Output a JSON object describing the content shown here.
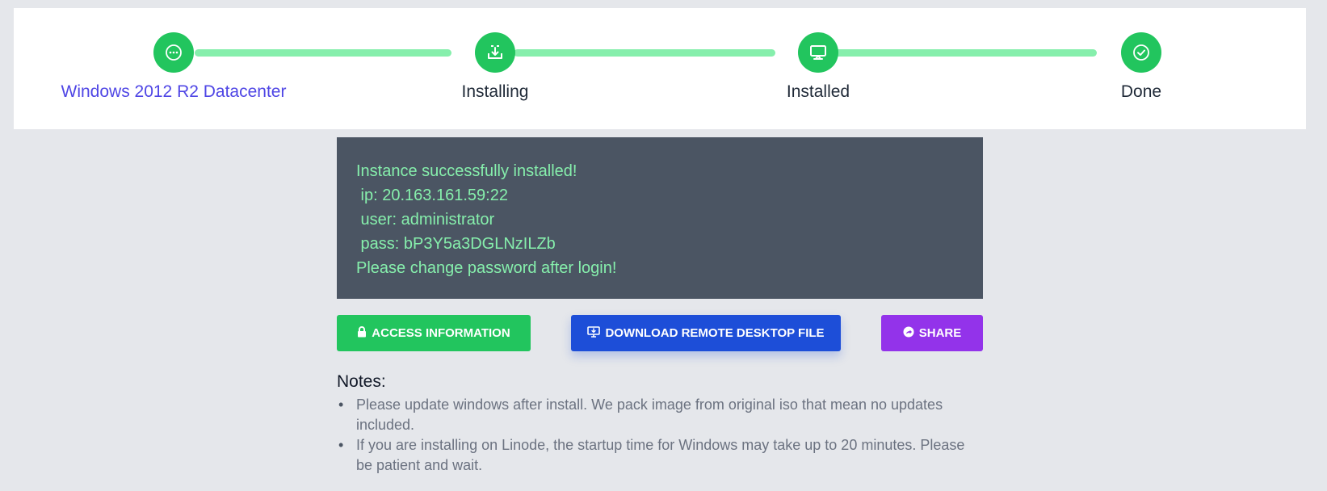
{
  "stepper": {
    "steps": [
      {
        "label": "Windows 2012 R2 Datacenter",
        "icon": "more-dots-icon"
      },
      {
        "label": "Installing",
        "icon": "download-tray-icon"
      },
      {
        "label": "Installed",
        "icon": "monitor-icon"
      },
      {
        "label": "Done",
        "icon": "check-circle-icon"
      }
    ],
    "colors": {
      "circle": "#22c55e",
      "connector": "#86efac",
      "link": "#4f46e5"
    }
  },
  "console": {
    "lines": [
      "Instance successfully installed!",
      " ip: 20.163.161.59:22",
      " user: administrator",
      " pass: bP3Y5a3DGLNzILZb",
      "Please change password after login!"
    ]
  },
  "actions": {
    "access_label": "ACCESS INFORMATION",
    "download_label": "DOWNLOAD REMOTE DESKTOP FILE",
    "share_label": "SHARE",
    "colors": {
      "access": "#22c55e",
      "download": "#1d4ed8",
      "share": "#9333ea"
    }
  },
  "notes": {
    "title": "Notes:",
    "items": [
      "Please update windows after install. We pack image from original iso that mean no updates included.",
      "If you are installing on Linode, the startup time for Windows may take up to 20 minutes. Please be patient and wait."
    ]
  }
}
